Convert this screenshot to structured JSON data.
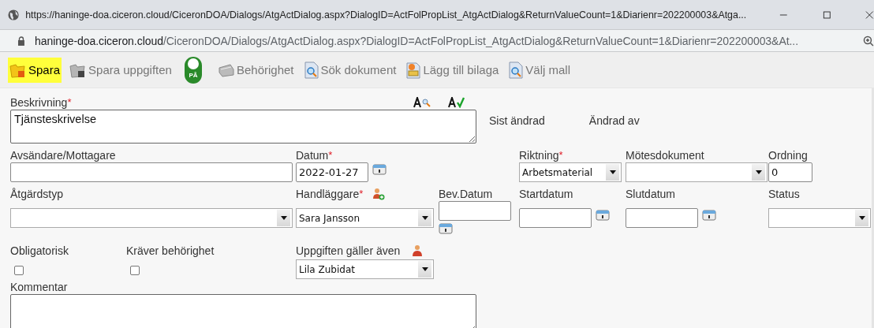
{
  "browser": {
    "title": "https://haninge-doa.ciceron.cloud/CiceronDOA/Dialogs/AtgActDialog.aspx?DialogID=ActFolPropList_AtgActDialog&ReturnValueCount=1&Diarienr=202200003&Atga...",
    "address_host": "haninge-doa.ciceron.cloud",
    "address_path": "/CiceronDOA/Dialogs/AtgActDialog.aspx?DialogID=ActFolPropList_AtgActDialog&ReturnValueCount=1&Diarienr=202200003&At..."
  },
  "toolbar": [
    {
      "kind": "save",
      "label": "Spara",
      "highlighted": true,
      "disabled": false
    },
    {
      "kind": "save",
      "label": "Spara uppgiften",
      "highlighted": false,
      "disabled": true
    },
    {
      "kind": "toggle",
      "label": "PÅ",
      "on": true
    },
    {
      "kind": "permission",
      "label": "Behörighet",
      "highlighted": false,
      "disabled": true
    },
    {
      "kind": "search",
      "label": "Sök dokument",
      "highlighted": false,
      "disabled": false
    },
    {
      "kind": "attach",
      "label": "Lägg till bilaga",
      "highlighted": false,
      "disabled": false
    },
    {
      "kind": "search",
      "label": "Välj mall",
      "highlighted": false,
      "disabled": false
    }
  ],
  "form": {
    "beskrivning": {
      "label": "Beskrivning",
      "required_mark": "*",
      "value": "Tjänsteskrivelse"
    },
    "sist_andrad": {
      "label": "Sist ändrad"
    },
    "andrad_av": {
      "label": "Ändrad av"
    },
    "avsandare": {
      "label": "Avsändare/Mottagare"
    },
    "datum": {
      "label": "Datum",
      "required_mark": "*",
      "value": "2022-01-27"
    },
    "riktning": {
      "label": "Riktning",
      "required_mark": "*",
      "value": "Arbetsmaterial"
    },
    "motesdokument": {
      "label": "Mötesdokument"
    },
    "ordning": {
      "label": "Ordning",
      "value": "0"
    },
    "atgardstyp": {
      "label": "Åtgärdstyp"
    },
    "handlaggare": {
      "label": "Handläggare",
      "required_mark": "*",
      "value": "Sara Jansson"
    },
    "bev_datum": {
      "label": "Bev.Datum"
    },
    "startdatum": {
      "label": "Startdatum"
    },
    "slutdatum": {
      "label": "Slutdatum"
    },
    "status": {
      "label": "Status"
    },
    "obligatorisk": {
      "label": "Obligatorisk",
      "checked": false
    },
    "kraver_behorighet": {
      "label": "Kräver behörighet",
      "checked": false
    },
    "uppgiften_galler_aven": {
      "label": "Uppgiften gäller även",
      "value": "Lila Zubidat"
    },
    "kommentar": {
      "label": "Kommentar"
    }
  }
}
